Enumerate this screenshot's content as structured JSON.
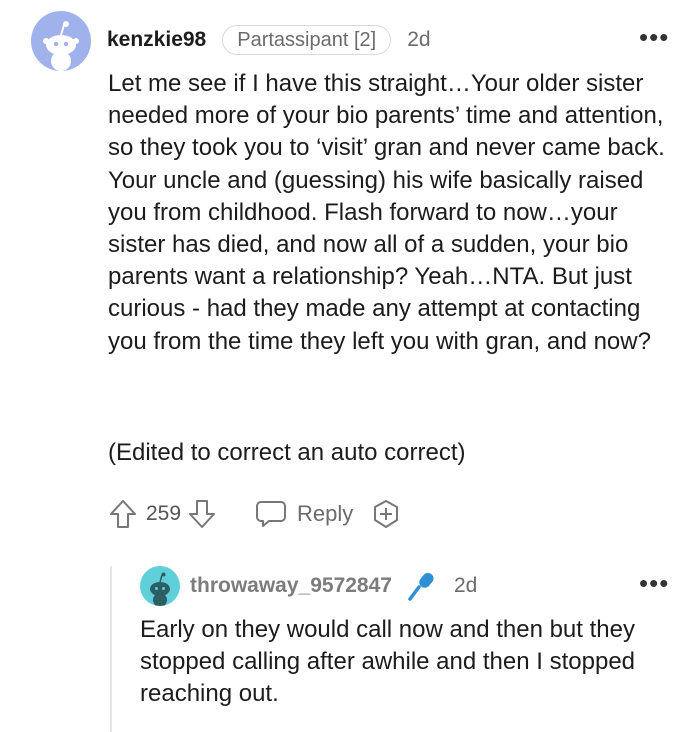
{
  "comment": {
    "username": "kenzkie98",
    "flair": "Partassipant [2]",
    "age": "2d",
    "more_label": "•••",
    "body": "Let me see if I have this straight…Your older sister needed more of your bio parents’ time and attention, so they took you to ‘visit’ gran and never came back. Your uncle and (guessing) his wife basically raised you from childhood. Flash forward to now…your sister has died, and now all of a sudden, your bio parents want a relationship? Yeah…NTA. But just curious - had they made any attempt at contacting you from the time they left you with gran, and now?",
    "edit_note": "(Edited to correct an auto correct)",
    "score": "259",
    "reply_label": "Reply",
    "avatar_color": "#9fb2ec"
  },
  "reply": {
    "username": "throwaway_9572847",
    "age": "2d",
    "more_label": "•••",
    "body": "Early on they would call now and then but they stopped calling after awhile and then I stopped reaching out.",
    "avatar_color": "#5fd0d9",
    "mic_color": "#2d8fd5"
  }
}
